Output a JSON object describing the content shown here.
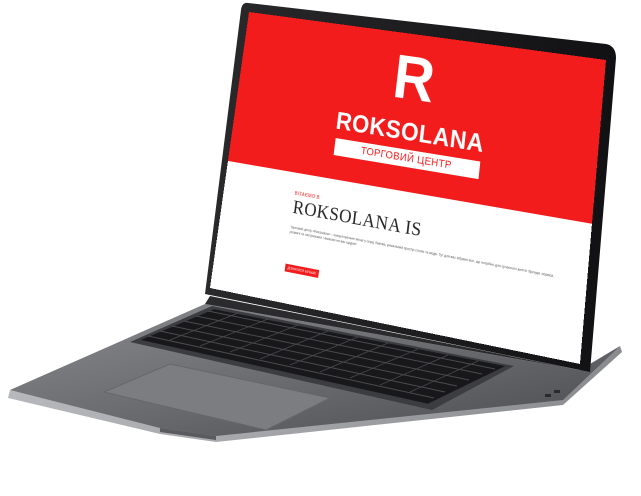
{
  "site": {
    "logo_letter": "R",
    "brand_name": "ROKSOLANA",
    "brand_subtitle": "ТОРГОВИЙ ЦЕНТР"
  },
  "about": {
    "kicker": "ВІТАЄМО В",
    "title": "ROKSOLANA IS",
    "body": "Торговий центр «Roksolana» – концептуальне місце у серці Львова, унікальний простір стилю та моди. Тут для вас зібрано все, що потрібно для сучасного життя: бренди, сервіси, розваги та гастрономія. Чекаємо на вас щодня!",
    "button_label": "ДІЗНАТИСЯ БІЛЬШЕ"
  },
  "colors": {
    "brand_red": "#f31c1c",
    "body_gray": "#6a6a6c",
    "bezel": "#0b0b0c"
  }
}
